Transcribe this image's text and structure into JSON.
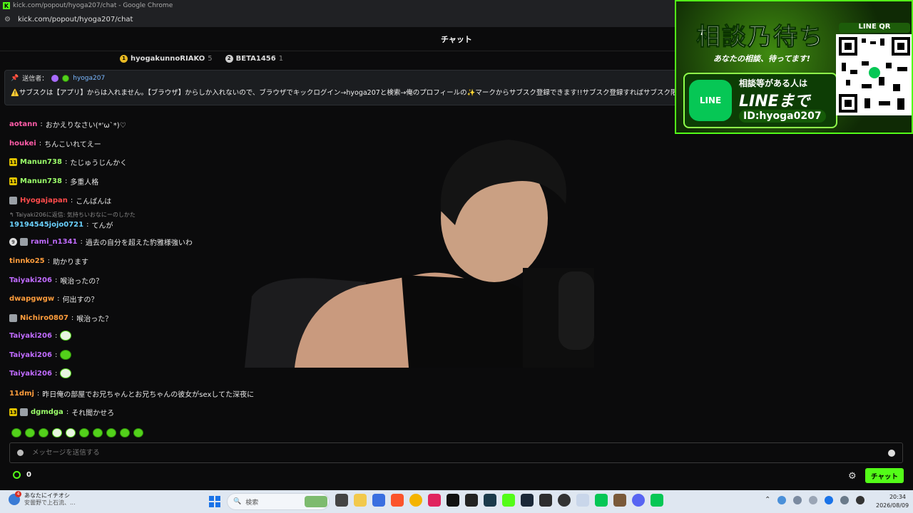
{
  "browser": {
    "window_title": "kick.com/popout/hyoga207/chat - Google Chrome",
    "url": "kick.com/popout/hyoga207/chat"
  },
  "chat": {
    "header": "チャット",
    "top_gifters": [
      {
        "name": "hyogakunnoRIAKO",
        "count": "5",
        "color": "#e8b923"
      },
      {
        "name": "BETA1456",
        "count": "1",
        "color": "#cfcfcf"
      }
    ],
    "pinned": {
      "label": "送信者：",
      "user": "hyoga207",
      "text": "⚠️サブスクは【アプリ】からは入れません。【ブラウザ】からしか入れないので、ブラウザでキックログイン→hyoga207と検索→俺のプロフィールの✨マークからサブスク登録できます!!サブスク登録すればサブスク限定"
    },
    "messages": [
      {
        "user": "aotann",
        "color": "#ff5ca8",
        "text": "おかえりなさい(*'ω`*)♡"
      },
      {
        "user": "houkei",
        "color": "#ff5ca8",
        "text": "ちんこいれてえー"
      },
      {
        "user": "Manun738",
        "color": "#9bff6a",
        "text": "たじゅうじんかく",
        "sub": "11"
      },
      {
        "user": "Manun738",
        "color": "#9bff6a",
        "text": "多重人格",
        "sub": "11"
      },
      {
        "user": "Hyogajapan",
        "color": "#ff4b4b",
        "text": "こんばんは"
      },
      {
        "user": "19194545jojo0721",
        "color": "#6ad1ff",
        "text": "てんが",
        "reply": "Taiyaki206に返信: 気持ちいおなにーのしかた"
      },
      {
        "user": "rami_n1341",
        "color": "#c06bff",
        "text": "過去の自分を超えた豹雅様強いわ",
        "circle": "9"
      },
      {
        "user": "tinnko25",
        "color": "#ff9d3c",
        "text": "助かります"
      },
      {
        "user": "Taiyaki206",
        "color": "#c06bff",
        "text": "喉治ったの？"
      },
      {
        "user": "dwapgwgw",
        "color": "#ff9d3c",
        "text": "何出すの？"
      },
      {
        "user": "Nichiro0807",
        "color": "#ff9d3c",
        "text": "喉治った？"
      },
      {
        "user": "Taiyaki206",
        "color": "#c06bff",
        "text": ""
      },
      {
        "user": "Taiyaki206",
        "color": "#c06bff",
        "text": ""
      },
      {
        "user": "Taiyaki206",
        "color": "#c06bff",
        "text": ""
      },
      {
        "user": "11dmj",
        "color": "#ff9d3c",
        "text": "昨日俺の部屋でお兄ちゃんとお兄ちゃんの彼女がsexしてた深夜に"
      },
      {
        "user": "dgmdga",
        "color": "#9bff6a",
        "text": "それ聞かせろ",
        "sub": "13"
      }
    ],
    "input_placeholder": "メッセージを送信する",
    "points": "0",
    "send_label": "チャット"
  },
  "promo": {
    "title": "相談乃待ち",
    "subtitle": "あなたの相談、待ってます!",
    "line_logo": "LINE",
    "line1": "相談等がある人は",
    "line2": "LINEまで",
    "line3": "ID:hyoga0207",
    "qr_label": "LINE QR"
  },
  "taskbar": {
    "news_title": "あなたにイチオシ",
    "news_sub": "安曇野で上石流、...",
    "news_badge": "4",
    "search_label": "検索",
    "time": "20:34",
    "date": "2026/08/09"
  },
  "colors": {
    "accent": "#53fc18",
    "background": "#0b0b0c"
  }
}
